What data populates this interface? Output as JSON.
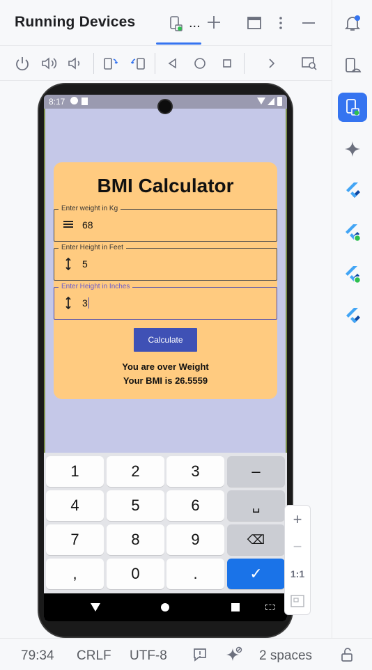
{
  "ide": {
    "panel_title": "Running Devices",
    "tab_more": "...",
    "colors": {
      "accent": "#3574f0",
      "status_green": "#2ebf4f"
    }
  },
  "toolbar": {
    "icons": [
      "power-icon",
      "volume-up-icon",
      "volume-down-icon",
      "rotate-left-icon",
      "rotate-right-icon",
      "back-icon",
      "home-icon",
      "overview-icon",
      "more-chevron-icon",
      "screenshot-search-icon"
    ]
  },
  "rightbar": {
    "icons": [
      "notifications-icon",
      "device-manager-icon",
      "running-devices-icon",
      "gemini-icon",
      "flutter-icon",
      "flutter-inspector-icon",
      "flutter-performance-icon",
      "flutter-outline-icon"
    ]
  },
  "phone": {
    "status": {
      "time": "8:17"
    },
    "app": {
      "title": "BMI Calculator",
      "weight": {
        "label": "Enter weight in Kg",
        "value": "68"
      },
      "feet": {
        "label": "Enter Height in Feet",
        "value": "5"
      },
      "inches": {
        "label": "Enter Height in Inches",
        "value": "3"
      },
      "calculate_label": "Calculate",
      "result_line1": "You are over Weight",
      "result_line2": "Your BMI is 26.5559",
      "colors": {
        "card": "#ffcb80",
        "button": "#3f51b5",
        "background": "#c5c8e8"
      }
    },
    "keyboard": {
      "rows": [
        [
          "1",
          "2",
          "3",
          "–"
        ],
        [
          "4",
          "5",
          "6",
          "␣"
        ],
        [
          "7",
          "8",
          "9",
          "⌫"
        ],
        [
          ",",
          "0",
          ".",
          "✓"
        ]
      ]
    }
  },
  "zoom": {
    "plus": "+",
    "minus": "−",
    "one_to_one": "1:1"
  },
  "statusbar": {
    "position": "79:34",
    "line_sep": "CRLF",
    "encoding": "UTF-8",
    "indent": "2 spaces"
  }
}
